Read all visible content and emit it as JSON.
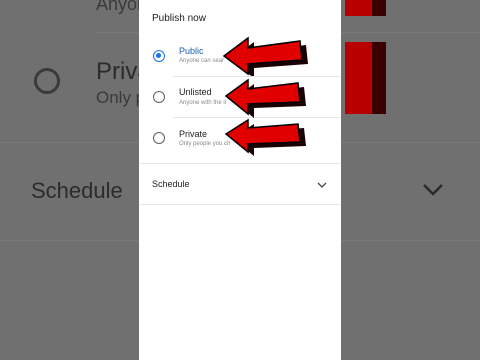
{
  "dialog": {
    "title": "Publish now",
    "options": [
      {
        "label": "Public",
        "description": "Anyone can sear",
        "selected": true
      },
      {
        "label": "Unlisted",
        "description": "Anyone with the li",
        "selected": false
      },
      {
        "label": "Private",
        "description": "Only people you ch",
        "selected": false
      }
    ],
    "schedule_label": "Schedule"
  },
  "background": {
    "top_text": "Anyone",
    "private_label": "Priva",
    "private_sub": "Only p",
    "schedule_label": "Schedule"
  },
  "colors": {
    "accent": "#1a73e8",
    "arrow_red": "#e00000",
    "backdrop": "#707070"
  }
}
